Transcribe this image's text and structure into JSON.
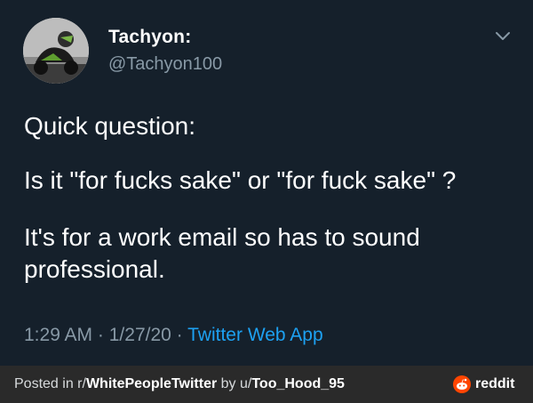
{
  "tweet": {
    "author_name": "Tachyon:",
    "author_handle": "@Tachyon100",
    "body_lines": [
      "Quick question:",
      "Is it \"for fucks sake\" or \"for fuck sake\" ?",
      "It's for a work email so has to sound professional."
    ],
    "time": "1:29 AM",
    "separator": "·",
    "date": "1/27/20",
    "source": "Twitter Web App"
  },
  "footer": {
    "prefix": "Posted in r/",
    "subreddit": "WhitePeopleTwitter",
    "by": " by u/",
    "username": "Too_Hood_95",
    "brand": "reddit"
  },
  "icons": {
    "chevron": "chevron-down-icon",
    "reddit": "reddit-logo-icon"
  },
  "colors": {
    "background": "#15202b",
    "muted": "#8899a6",
    "link": "#1da1f2",
    "footer_bg": "#2a2a2a",
    "reddit": "#ff4500"
  }
}
